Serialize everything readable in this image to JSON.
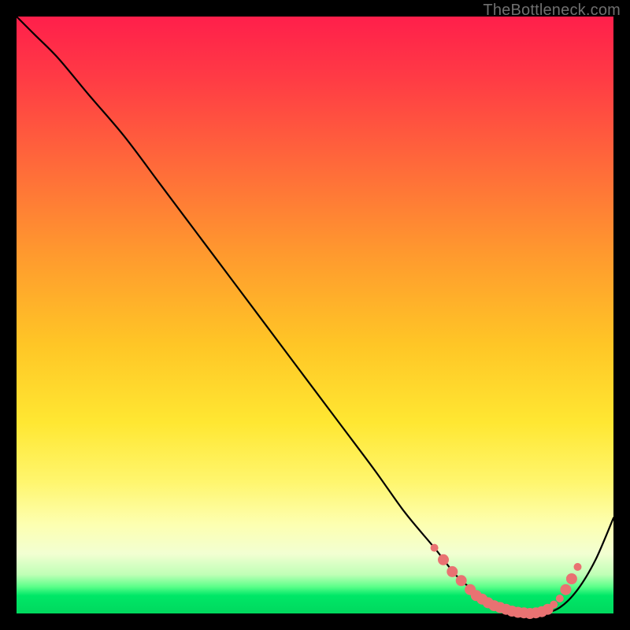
{
  "watermark": "TheBottleneck.com",
  "chart_data": {
    "type": "line",
    "title": "",
    "xlabel": "",
    "ylabel": "",
    "xlim": [
      0,
      100
    ],
    "ylim": [
      0,
      100
    ],
    "grid": false,
    "legend": false,
    "series": [
      {
        "name": "bottleneck-curve",
        "x": [
          0,
          3,
          7,
          12,
          18,
          24,
          30,
          36,
          42,
          48,
          54,
          60,
          65,
          70,
          74,
          78,
          82,
          85,
          88,
          91,
          94,
          97,
          100
        ],
        "y": [
          100,
          97,
          93,
          87,
          80,
          72,
          64,
          56,
          48,
          40,
          32,
          24,
          17,
          11,
          6,
          3,
          1,
          0,
          0,
          1,
          4,
          9,
          16
        ],
        "color": "#000000"
      }
    ],
    "markers": {
      "name": "optimal-range-dots",
      "color": "#e97272",
      "radius_large": 7,
      "radius_small": 5,
      "points": [
        {
          "x": 70.0,
          "y": 11.0,
          "r": "small"
        },
        {
          "x": 71.5,
          "y": 9.0,
          "r": "large"
        },
        {
          "x": 73.0,
          "y": 7.0,
          "r": "large"
        },
        {
          "x": 74.5,
          "y": 5.5,
          "r": "large"
        },
        {
          "x": 76.0,
          "y": 4.0,
          "r": "large"
        },
        {
          "x": 77.0,
          "y": 3.0,
          "r": "large"
        },
        {
          "x": 78.0,
          "y": 2.4,
          "r": "large"
        },
        {
          "x": 79.0,
          "y": 1.8,
          "r": "large"
        },
        {
          "x": 80.0,
          "y": 1.3,
          "r": "large"
        },
        {
          "x": 81.0,
          "y": 1.0,
          "r": "large"
        },
        {
          "x": 82.0,
          "y": 0.7,
          "r": "large"
        },
        {
          "x": 83.0,
          "y": 0.4,
          "r": "large"
        },
        {
          "x": 84.0,
          "y": 0.2,
          "r": "large"
        },
        {
          "x": 85.0,
          "y": 0.1,
          "r": "large"
        },
        {
          "x": 86.0,
          "y": 0.0,
          "r": "large"
        },
        {
          "x": 87.0,
          "y": 0.1,
          "r": "large"
        },
        {
          "x": 88.0,
          "y": 0.3,
          "r": "large"
        },
        {
          "x": 89.0,
          "y": 0.7,
          "r": "large"
        },
        {
          "x": 90.0,
          "y": 1.5,
          "r": "small"
        },
        {
          "x": 91.0,
          "y": 2.5,
          "r": "small"
        },
        {
          "x": 92.0,
          "y": 4.0,
          "r": "large"
        },
        {
          "x": 93.0,
          "y": 5.8,
          "r": "large"
        },
        {
          "x": 94.0,
          "y": 7.8,
          "r": "small"
        }
      ]
    },
    "background_gradient": {
      "top": "#ff1f4b",
      "mid": "#ffe732",
      "bottom": "#00d85e"
    }
  }
}
